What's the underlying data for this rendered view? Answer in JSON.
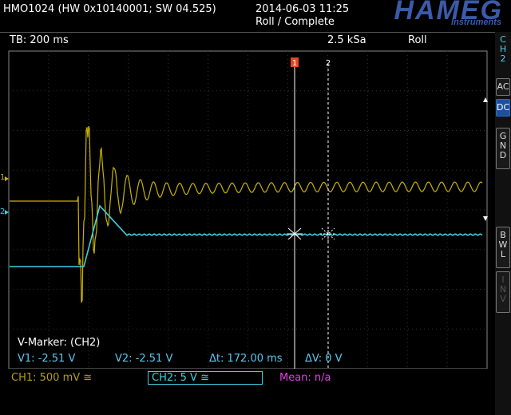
{
  "header": {
    "device_info": "HMO1024 (HW 0x10140001; SW 04.525)",
    "datetime": "2014-06-03 11:25",
    "acquisition_status": "Roll / Complete",
    "brand": "HAMEG",
    "brand_sub": "Instruments"
  },
  "settings": {
    "timebase": "TB: 200 ms",
    "sample_rate": "2.5 kSa",
    "mode": "Roll"
  },
  "sidebar": {
    "channel_label": "CH2",
    "buttons": [
      {
        "label": "AC",
        "active": false
      },
      {
        "label": "DC",
        "active": true
      },
      {
        "label": "GND",
        "active": false
      },
      {
        "label": "BWL",
        "active": false
      },
      {
        "label": "INV",
        "active": false
      }
    ]
  },
  "markers": {
    "title": "V-Marker: (CH2)",
    "v1": "V1: -2.51 V",
    "v2": "V2: -2.51 V",
    "delta_t": "Δt: 172.00 ms",
    "delta_v": "ΔV: 0 V",
    "cursor1_label": "1",
    "cursor2_label": "2"
  },
  "channels": {
    "ch1_setting": "CH1: 500 mV ≅",
    "ch2_setting": "CH2: 5 V ≅",
    "mean_value": "Mean: n/a",
    "ch1_color": "#c8b400",
    "ch2_color": "#3fcfe0",
    "ch1_marker": "1",
    "ch2_marker": "2"
  }
}
